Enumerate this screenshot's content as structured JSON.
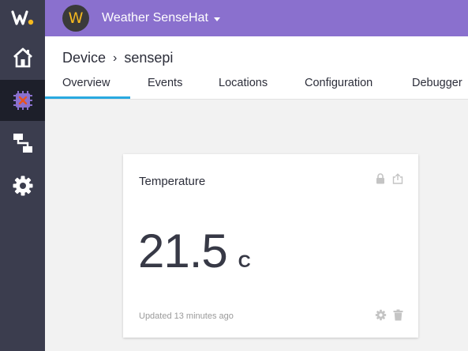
{
  "app": {
    "avatar_letter": "W",
    "name": "Weather SenseHat"
  },
  "sidebar": {
    "items": [
      {
        "icon": "home-icon",
        "active": false
      },
      {
        "icon": "device-chip-icon",
        "active": true
      },
      {
        "icon": "workflow-icon",
        "active": false
      },
      {
        "icon": "gear-icon",
        "active": false
      }
    ]
  },
  "breadcrumb": {
    "parent": "Device",
    "separator": "›",
    "current": "sensepi"
  },
  "tabs": [
    {
      "label": "Overview",
      "active": true
    },
    {
      "label": "Events",
      "active": false
    },
    {
      "label": "Locations",
      "active": false
    },
    {
      "label": "Configuration",
      "active": false
    },
    {
      "label": "Debugger",
      "active": false
    }
  ],
  "card": {
    "title": "Temperature",
    "value": "21.5",
    "unit": "C",
    "updated": "Updated 13 minutes ago"
  },
  "colors": {
    "topbar": "#8a70ce",
    "sidebar": "#3b3d4e",
    "sidebar_active": "#1d1f2a",
    "tab_underline": "#29a9e0",
    "logo_dot": "#f5b91f"
  }
}
